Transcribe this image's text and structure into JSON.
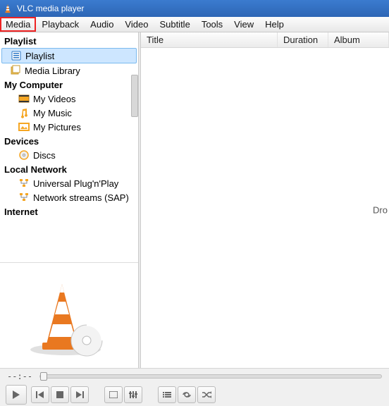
{
  "window": {
    "title": "VLC media player"
  },
  "menu": {
    "items": [
      "Media",
      "Playback",
      "Audio",
      "Video",
      "Subtitle",
      "Tools",
      "View",
      "Help"
    ],
    "highlighted_index": 0
  },
  "sidebar": {
    "sections": [
      {
        "header": "Playlist",
        "items": [
          {
            "label": "Playlist",
            "icon": "playlist-icon",
            "selected": true
          },
          {
            "label": "Media Library",
            "icon": "media-library-icon"
          }
        ]
      },
      {
        "header": "My Computer",
        "items": [
          {
            "label": "My Videos",
            "icon": "video-folder-icon"
          },
          {
            "label": "My Music",
            "icon": "music-folder-icon"
          },
          {
            "label": "My Pictures",
            "icon": "pictures-folder-icon"
          }
        ]
      },
      {
        "header": "Devices",
        "items": [
          {
            "label": "Discs",
            "icon": "disc-icon"
          }
        ]
      },
      {
        "header": "Local Network",
        "items": [
          {
            "label": "Universal Plug'n'Play",
            "icon": "network-icon"
          },
          {
            "label": "Network streams (SAP)",
            "icon": "network-icon"
          }
        ]
      },
      {
        "header": "Internet",
        "items": []
      }
    ]
  },
  "playlist_view": {
    "columns": [
      "Title",
      "Duration",
      "Album"
    ],
    "empty_hint": "Dro"
  },
  "timebar": {
    "elapsed": "--:--"
  },
  "controls": {
    "play": "play-icon",
    "prev": "prev-icon",
    "stop": "stop-icon",
    "next": "next-icon",
    "fullscreen": "fullscreen-icon",
    "ext": "extended-settings-icon",
    "playlist_toggle": "playlist-toggle-icon",
    "loop": "loop-icon",
    "shuffle": "shuffle-icon"
  }
}
